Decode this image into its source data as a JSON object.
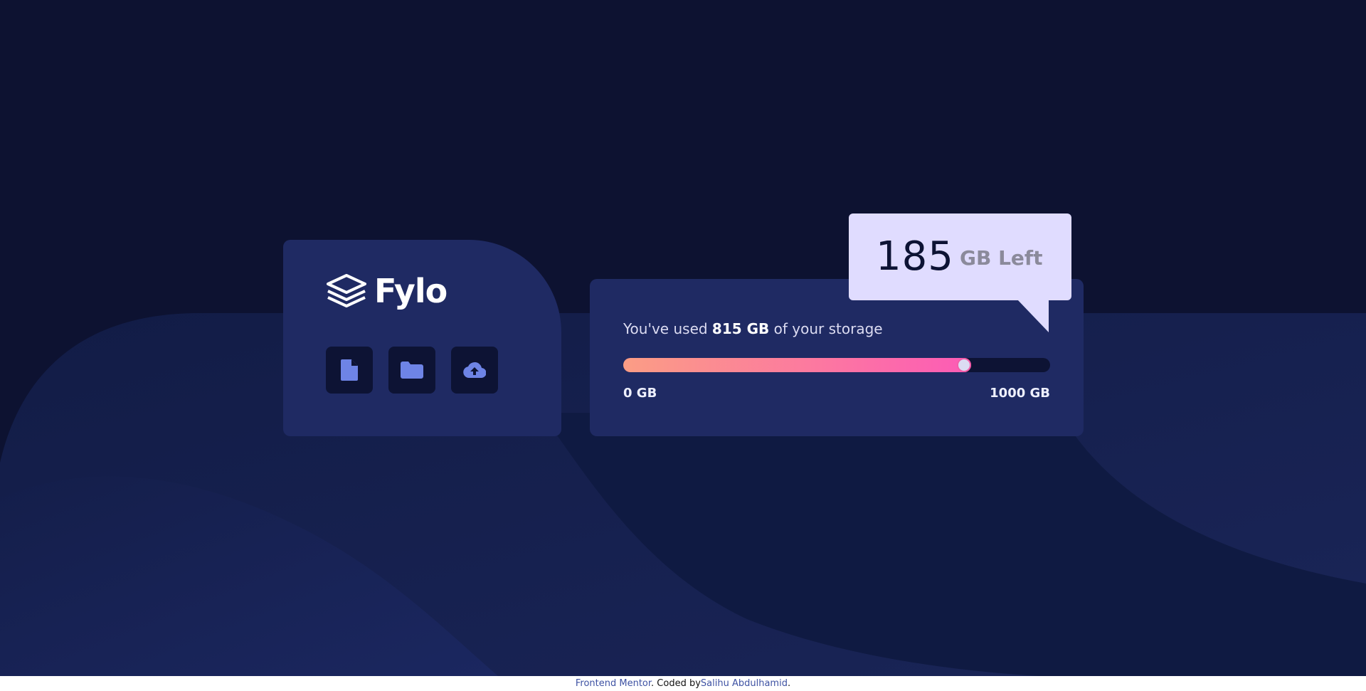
{
  "brand": {
    "name": "Fylo",
    "logo_icon": "layers-icon"
  },
  "file_actions": [
    {
      "icon": "document-icon"
    },
    {
      "icon": "folder-icon"
    },
    {
      "icon": "cloud-upload-icon"
    }
  ],
  "storage": {
    "used_prefix": "You've used ",
    "used_amount": "815 GB",
    "used_suffix": " of your storage",
    "used_fraction": 0.815,
    "min_label": "0 GB",
    "max_label": "1000 GB",
    "remaining_number": "185",
    "remaining_label": "GB Left"
  },
  "footer": {
    "challenge_link": "Frontend Mentor",
    "mid_text": ". Coded by",
    "author_link": "Salihu Abdulhamid",
    "end_text": "."
  },
  "colors": {
    "background": "#0d1231",
    "card": "#1f2a63",
    "bubble": "#e0dcff",
    "gradient_start": "#fb9d85",
    "gradient_end": "#fc5bb6"
  }
}
